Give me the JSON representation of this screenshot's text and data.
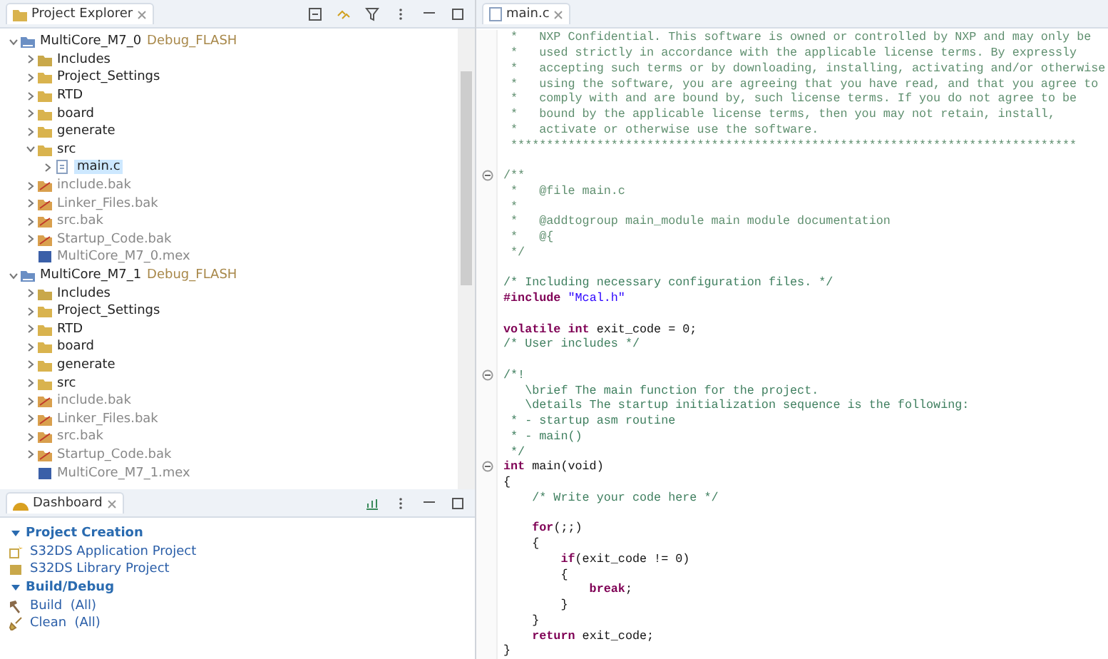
{
  "project_explorer": {
    "title": "Project Explorer",
    "tree": [
      {
        "label": "MultiCore_M7_0",
        "suffix": "Debug_FLASH",
        "kind": "project",
        "expanded": true,
        "selected": false,
        "children": [
          {
            "label": "Includes",
            "kind": "includes",
            "expanded": false,
            "selected": false
          },
          {
            "label": "Project_Settings",
            "kind": "folder",
            "expanded": false,
            "selected": false
          },
          {
            "label": "RTD",
            "kind": "folder",
            "expanded": false,
            "selected": false
          },
          {
            "label": "board",
            "kind": "folder",
            "expanded": false,
            "selected": false
          },
          {
            "label": "generate",
            "kind": "folder",
            "expanded": false,
            "selected": false
          },
          {
            "label": "src",
            "kind": "folder",
            "expanded": true,
            "selected": false,
            "children": [
              {
                "label": "main.c",
                "kind": "file",
                "expanded": false,
                "selected": true
              }
            ]
          },
          {
            "label": "include.bak",
            "kind": "excluded",
            "expanded": false,
            "selected": false
          },
          {
            "label": "Linker_Files.bak",
            "kind": "excluded",
            "expanded": false,
            "selected": false
          },
          {
            "label": "src.bak",
            "kind": "excluded",
            "expanded": false,
            "selected": false
          },
          {
            "label": "Startup_Code.bak",
            "kind": "excluded",
            "expanded": false,
            "selected": false
          },
          {
            "label": "MultiCore_M7_0.mex",
            "kind": "mex",
            "selected": false
          }
        ]
      },
      {
        "label": "MultiCore_M7_1",
        "suffix": "Debug_FLASH",
        "kind": "project",
        "expanded": true,
        "selected": false,
        "children": [
          {
            "label": "Includes",
            "kind": "includes",
            "expanded": false,
            "selected": false
          },
          {
            "label": "Project_Settings",
            "kind": "folder",
            "expanded": false,
            "selected": false
          },
          {
            "label": "RTD",
            "kind": "folder",
            "expanded": false,
            "selected": false
          },
          {
            "label": "board",
            "kind": "folder",
            "expanded": false,
            "selected": false
          },
          {
            "label": "generate",
            "kind": "folder",
            "expanded": false,
            "selected": false
          },
          {
            "label": "src",
            "kind": "folder",
            "expanded": false,
            "selected": false
          },
          {
            "label": "include.bak",
            "kind": "excluded",
            "expanded": false,
            "selected": false
          },
          {
            "label": "Linker_Files.bak",
            "kind": "excluded",
            "expanded": false,
            "selected": false
          },
          {
            "label": "src.bak",
            "kind": "excluded",
            "expanded": false,
            "selected": false
          },
          {
            "label": "Startup_Code.bak",
            "kind": "excluded",
            "expanded": false,
            "selected": false
          },
          {
            "label": "MultiCore_M7_1.mex",
            "kind": "mex",
            "selected": false
          }
        ]
      }
    ]
  },
  "dashboard": {
    "title": "Dashboard",
    "sections": [
      {
        "title": "Project Creation",
        "expanded": true,
        "items": [
          {
            "label": "S32DS Application Project",
            "kind": "new-app"
          },
          {
            "label": "S32DS Library Project",
            "kind": "new-lib"
          }
        ]
      },
      {
        "title": "Build/Debug",
        "expanded": true,
        "items": [
          {
            "label": "Build  (All)",
            "kind": "build"
          },
          {
            "label": "Clean  (All)",
            "kind": "clean"
          }
        ]
      }
    ]
  },
  "editor": {
    "tab": "main.c",
    "lines": [
      {
        "kind": "code",
        "segs": [
          {
            "t": " *   NXP Confidential. This software is owned or controlled by NXP and may only be",
            "kind": "doc"
          }
        ]
      },
      {
        "kind": "code",
        "segs": [
          {
            "t": " *   used strictly in accordance with the applicable license terms. By expressly",
            "kind": "doc"
          }
        ]
      },
      {
        "kind": "code",
        "segs": [
          {
            "t": " *   accepting such terms or by downloading, installing, activating and/or otherwise",
            "kind": "doc"
          }
        ]
      },
      {
        "kind": "code",
        "segs": [
          {
            "t": " *   using the software, you are agreeing that you have read, and that you agree to",
            "kind": "doc"
          }
        ]
      },
      {
        "kind": "code",
        "segs": [
          {
            "t": " *   comply with and are bound by, such license terms. If you do not agree to be",
            "kind": "doc"
          }
        ]
      },
      {
        "kind": "code",
        "segs": [
          {
            "t": " *   bound by the applicable license terms, then you may not retain, install,",
            "kind": "doc"
          }
        ]
      },
      {
        "kind": "code",
        "segs": [
          {
            "t": " *   activate or otherwise use the software.",
            "kind": "doc"
          }
        ]
      },
      {
        "kind": "code",
        "segs": [
          {
            "t": " *******************************************************************************",
            "kind": "doc"
          }
        ]
      },
      {
        "kind": "blank"
      },
      {
        "kind": "code",
        "fold": true,
        "segs": [
          {
            "t": "/**",
            "kind": "doc"
          }
        ]
      },
      {
        "kind": "code",
        "segs": [
          {
            "t": " *   @file main.c",
            "kind": "doc"
          }
        ]
      },
      {
        "kind": "code",
        "segs": [
          {
            "t": " *",
            "kind": "doc"
          }
        ]
      },
      {
        "kind": "code",
        "segs": [
          {
            "t": " *   @addtogroup main_module main module documentation",
            "kind": "doc"
          }
        ]
      },
      {
        "kind": "code",
        "segs": [
          {
            "t": " *   @{",
            "kind": "doc"
          }
        ]
      },
      {
        "kind": "code",
        "segs": [
          {
            "t": " */",
            "kind": "doc"
          }
        ]
      },
      {
        "kind": "blank"
      },
      {
        "kind": "code",
        "segs": [
          {
            "t": "/* Including necessary configuration files. */",
            "kind": "comment"
          }
        ]
      },
      {
        "kind": "code",
        "segs": [
          {
            "t": "#include",
            "kind": "keyword"
          },
          {
            "t": " \"Mcal.h\"",
            "kind": "string"
          }
        ]
      },
      {
        "kind": "blank"
      },
      {
        "kind": "code",
        "segs": [
          {
            "t": "volatile int",
            "kind": "keyword"
          },
          {
            "t": " exit_code = 0;",
            "kind": "plain"
          }
        ]
      },
      {
        "kind": "code",
        "segs": [
          {
            "t": "/* User includes */",
            "kind": "comment"
          }
        ]
      },
      {
        "kind": "blank"
      },
      {
        "kind": "code",
        "fold": true,
        "segs": [
          {
            "t": "/*!",
            "kind": "comment"
          }
        ]
      },
      {
        "kind": "code",
        "segs": [
          {
            "t": "   \\brief The main function for the project.",
            "kind": "comment"
          }
        ]
      },
      {
        "kind": "code",
        "segs": [
          {
            "t": "   \\details The startup initialization sequence is the following:",
            "kind": "comment"
          }
        ]
      },
      {
        "kind": "code",
        "segs": [
          {
            "t": " * - startup asm routine",
            "kind": "comment"
          }
        ]
      },
      {
        "kind": "code",
        "segs": [
          {
            "t": " * - main()",
            "kind": "comment"
          }
        ]
      },
      {
        "kind": "code",
        "segs": [
          {
            "t": " */",
            "kind": "comment"
          }
        ]
      },
      {
        "kind": "code",
        "fold": true,
        "segs": [
          {
            "t": "int",
            "kind": "keyword"
          },
          {
            "t": " main(void)",
            "kind": "plain"
          }
        ]
      },
      {
        "kind": "code",
        "segs": [
          {
            "t": "{",
            "kind": "plain"
          }
        ]
      },
      {
        "kind": "code",
        "segs": [
          {
            "t": "    /* Write your code here */",
            "kind": "comment"
          }
        ]
      },
      {
        "kind": "blank"
      },
      {
        "kind": "code",
        "segs": [
          {
            "t": "    for",
            "kind": "keyword"
          },
          {
            "t": "(;;)",
            "kind": "plain"
          }
        ]
      },
      {
        "kind": "code",
        "segs": [
          {
            "t": "    {",
            "kind": "plain"
          }
        ]
      },
      {
        "kind": "code",
        "segs": [
          {
            "t": "        if",
            "kind": "keyword"
          },
          {
            "t": "(exit_code != 0)",
            "kind": "plain"
          }
        ]
      },
      {
        "kind": "code",
        "segs": [
          {
            "t": "        {",
            "kind": "plain"
          }
        ]
      },
      {
        "kind": "code",
        "segs": [
          {
            "t": "            break",
            "kind": "keyword"
          },
          {
            "t": ";",
            "kind": "plain"
          }
        ]
      },
      {
        "kind": "code",
        "segs": [
          {
            "t": "        }",
            "kind": "plain"
          }
        ]
      },
      {
        "kind": "code",
        "segs": [
          {
            "t": "    }",
            "kind": "plain"
          }
        ]
      },
      {
        "kind": "code",
        "segs": [
          {
            "t": "    return",
            "kind": "keyword"
          },
          {
            "t": " exit_code;",
            "kind": "plain"
          }
        ]
      },
      {
        "kind": "code",
        "segs": [
          {
            "t": "}",
            "kind": "plain"
          }
        ]
      }
    ]
  }
}
